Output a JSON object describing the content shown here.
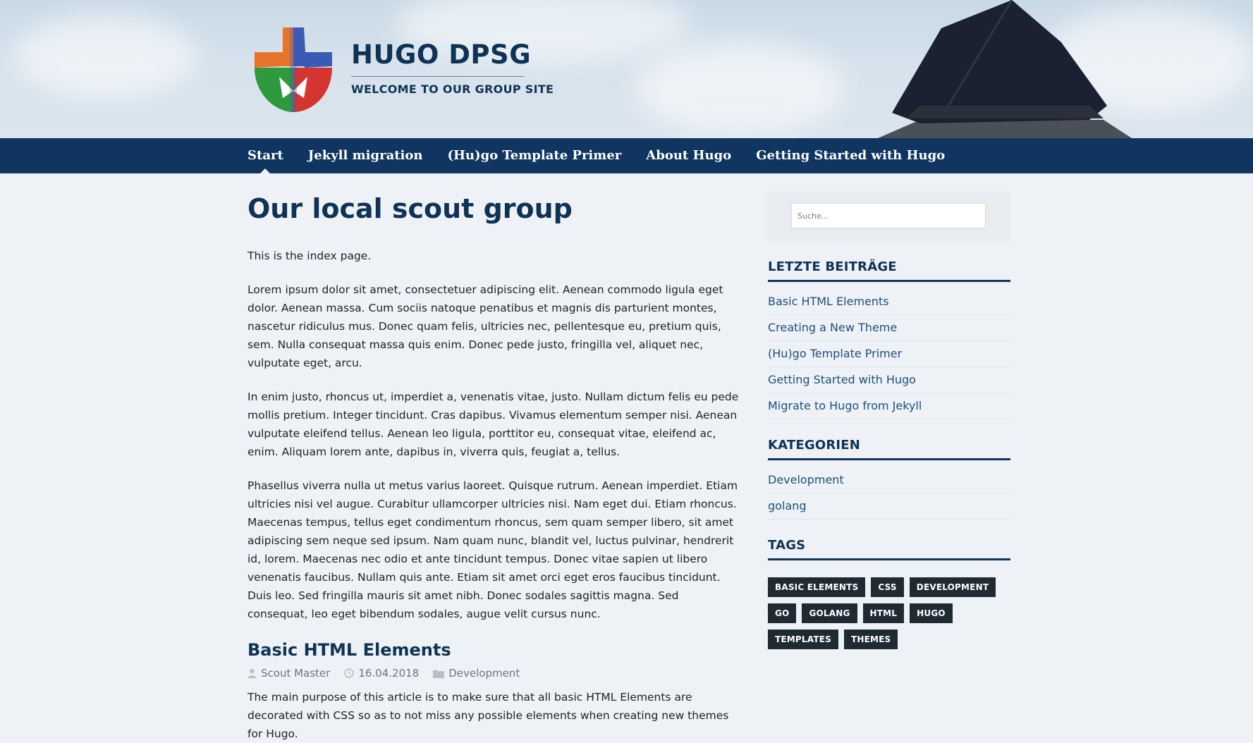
{
  "header": {
    "site_title": "HUGO DPSG",
    "site_subtitle": "WELCOME TO OUR GROUP SITE"
  },
  "nav": {
    "items": [
      {
        "label": "Start",
        "active": true
      },
      {
        "label": "Jekyll migration"
      },
      {
        "label": "(Hu)go Template Primer"
      },
      {
        "label": "About Hugo"
      },
      {
        "label": "Getting Started with Hugo"
      }
    ]
  },
  "main": {
    "title": "Our local scout group",
    "paragraphs": [
      "This is the index page.",
      "Lorem ipsum dolor sit amet, consectetuer adipiscing elit. Aenean commodo ligula eget dolor. Aenean massa. Cum sociis natoque penatibus et magnis dis parturient montes, nascetur ridiculus mus. Donec quam felis, ultricies nec, pellentesque eu, pretium quis, sem. Nulla consequat massa quis enim. Donec pede justo, fringilla vel, aliquet nec, vulputate eget, arcu.",
      "In enim justo, rhoncus ut, imperdiet a, venenatis vitae, justo. Nullam dictum felis eu pede mollis pretium. Integer tincidunt. Cras dapibus. Vivamus elementum semper nisi. Aenean vulputate eleifend tellus. Aenean leo ligula, porttitor eu, consequat vitae, eleifend ac, enim. Aliquam lorem ante, dapibus in, viverra quis, feugiat a, tellus.",
      "Phasellus viverra nulla ut metus varius laoreet. Quisque rutrum. Aenean imperdiet. Etiam ultricies nisi vel augue. Curabitur ullamcorper ultricies nisi. Nam eget dui. Etiam rhoncus. Maecenas tempus, tellus eget condimentum rhoncus, sem quam semper libero, sit amet adipiscing sem neque sed ipsum. Nam quam nunc, blandit vel, luctus pulvinar, hendrerit id, lorem. Maecenas nec odio et ante tincidunt tempus. Donec vitae sapien ut libero venenatis faucibus. Nullam quis ante. Etiam sit amet orci eget eros faucibus tincidunt. Duis leo. Sed fringilla mauris sit amet nibh. Donec sodales sagittis magna. Sed consequat, leo eget bibendum sodales, augue velit cursus nunc."
    ],
    "post": {
      "title": "Basic HTML Elements",
      "author": "Scout Master",
      "date": "16.04.2018",
      "category": "Development",
      "excerpt": "The main purpose of this article is to make sure that all basic HTML Elements are decorated with CSS so as to not miss any possible elements when creating new themes for Hugo."
    }
  },
  "sidebar": {
    "search_placeholder": "Suche...",
    "recent_title": "LETZTE BEITRÄGE",
    "recent": [
      "Basic HTML Elements",
      "Creating a New Theme",
      "(Hu)go Template Primer",
      "Getting Started with Hugo",
      "Migrate to Hugo from Jekyll"
    ],
    "categories_title": "KATEGORIEN",
    "categories": [
      "Development",
      "golang"
    ],
    "tags_title": "TAGS",
    "tags": [
      "BASIC ELEMENTS",
      "CSS",
      "DEVELOPMENT",
      "GO",
      "GOLANG",
      "HTML",
      "HUGO",
      "TEMPLATES",
      "THEMES"
    ]
  },
  "colors": {
    "nav_bg": "#0f3560",
    "title": "#0f3354",
    "link": "#1d4e7c",
    "tag_bg": "#1f2a33",
    "page_bg": "#eef2f6"
  }
}
